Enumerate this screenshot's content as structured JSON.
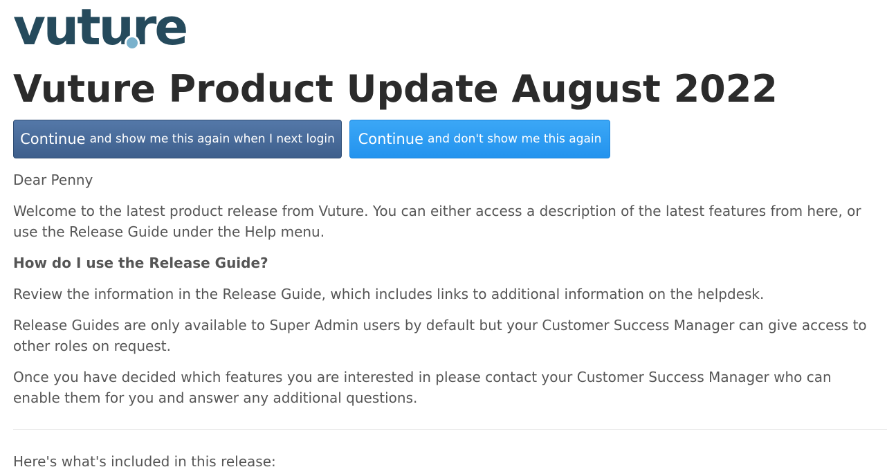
{
  "logo": {
    "text": "vuture",
    "colors": {
      "text": "#254a5c",
      "dot": "#7ab1cc"
    }
  },
  "title": "Vuture Product Update August 2022",
  "buttons": {
    "show_again": {
      "primary": "Continue",
      "secondary": "and show me this again when I next login",
      "color": "#4a6d9c"
    },
    "dont_show": {
      "primary": "Continue",
      "secondary": "and don't show me this again",
      "color": "#2a9bf1"
    }
  },
  "content": {
    "greeting": "Dear Penny",
    "welcome": "Welcome to the latest product release from Vuture. You can either access a description of the latest features from here, or use the Release Guide under the Help menu.",
    "question": "How do I use the Release Guide?",
    "review": "Review the information in the Release Guide, which includes links to additional information on the helpdesk.",
    "availability": "Release Guides are only available to Super Admin users by default but your Customer Success Manager can give access to other roles on request.",
    "contact": "Once you have decided which features you are interested in please contact your Customer Success Manager who can enable them for you and answer any additional questions.",
    "included": "Here's what's included in this release:"
  }
}
